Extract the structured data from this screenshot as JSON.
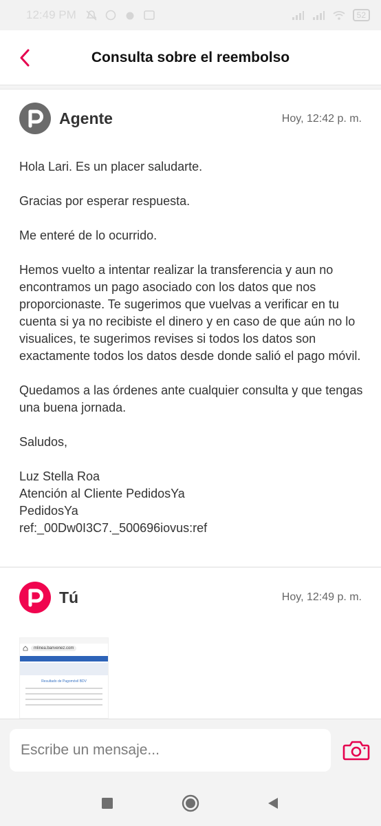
{
  "status_bar": {
    "time": "12:49 PM",
    "battery": "52"
  },
  "header": {
    "title": "Consulta sobre el reembolso"
  },
  "messages": [
    {
      "sender": "Agente",
      "time": "Hoy, 12:42 p. m.",
      "paragraphs": [
        "Hola Lari. Es un placer saludarte.",
        "Gracias por esperar respuesta.",
        "Me enteré de lo ocurrido.",
        "Hemos vuelto a intentar realizar la transferencia y aun no encontramos un pago asociado con los datos que nos proporcionaste. Te sugerimos que vuelvas a verificar en tu cuenta si ya no recibiste el dinero y en caso de que aún no lo visualices, te sugerimos revises si todos los datos son exactamente todos los datos desde donde salió el pago móvil.",
        "Quedamos a las órdenes ante cualquier consulta y que tengas una buena jornada.",
        "Saludos,"
      ],
      "signature": [
        "Luz Stella Roa",
        "Atención al Cliente PedidosYa",
        "PedidosYa",
        "ref:_00Dw0I3C7._500696iovus:ref"
      ]
    },
    {
      "sender": "Tú",
      "time": "Hoy, 12:49 p. m.",
      "attachment": {
        "url_text": "mlinea.banvenez.com",
        "caption": "Resultado de Pagomóvil BDV"
      }
    }
  ],
  "composer": {
    "placeholder": "Escribe un mensaje..."
  },
  "colors": {
    "accent": "#e5004e",
    "agent_avatar": "#6b6b6b",
    "user_avatar": "#f0054f"
  },
  "icons": [
    "back-arrow-icon",
    "camera-icon",
    "square-nav-icon",
    "home-circle-icon",
    "back-triangle-icon"
  ]
}
